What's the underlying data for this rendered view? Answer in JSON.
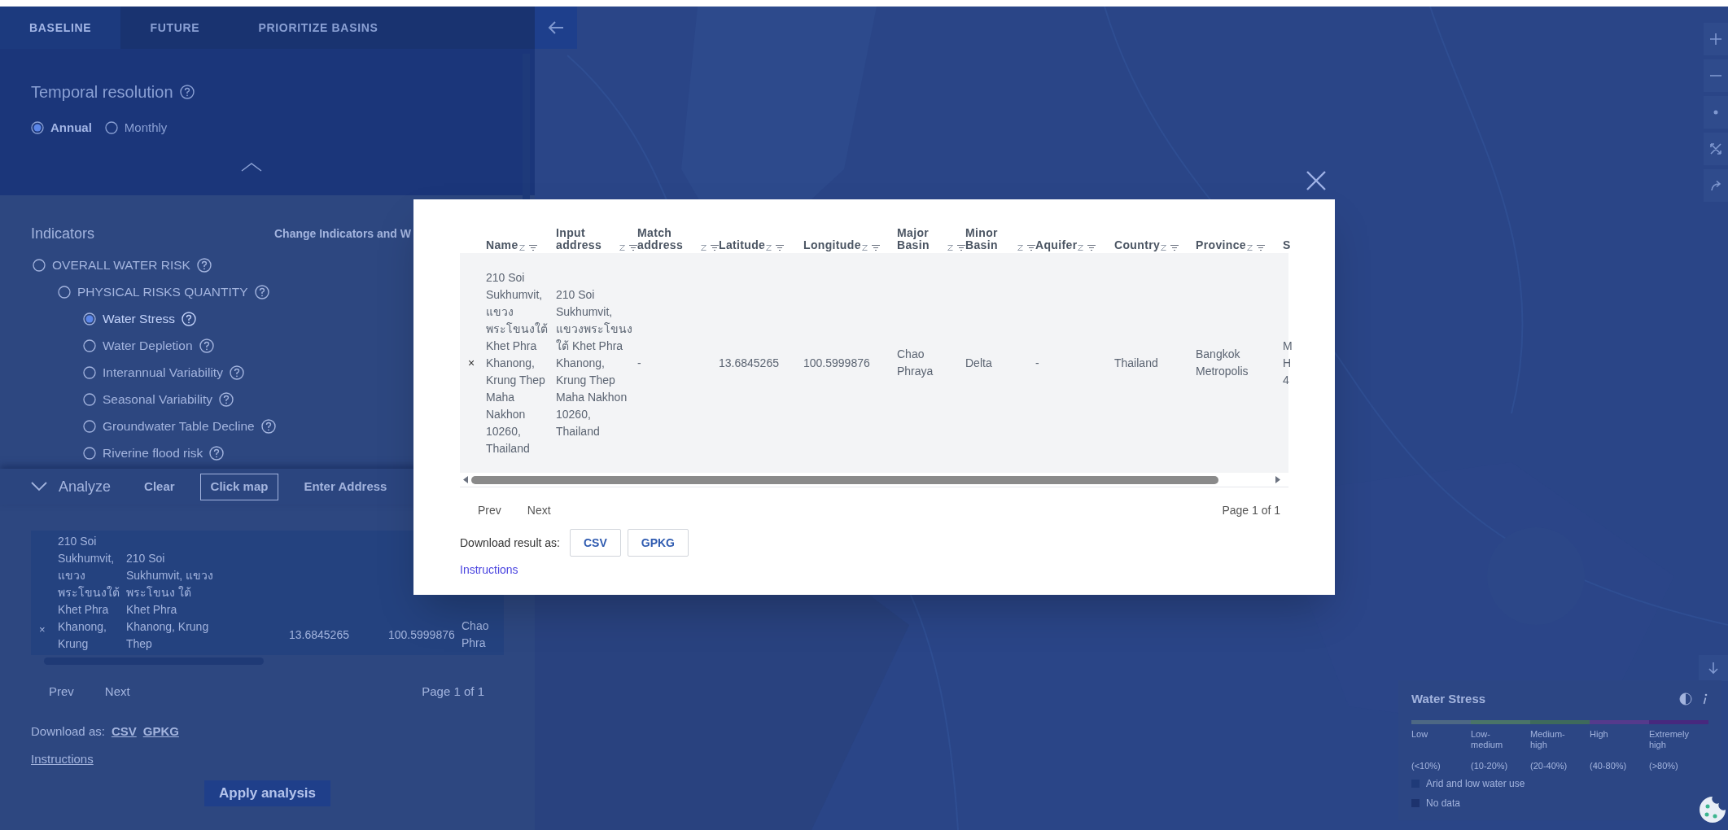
{
  "tabs": [
    {
      "label": "BASELINE",
      "selected": true
    },
    {
      "label": "FUTURE",
      "selected": false
    },
    {
      "label": "PRIORITIZE BASINS",
      "selected": false
    }
  ],
  "temporal_resolution": {
    "title": "Temporal resolution",
    "options": [
      {
        "label": "Annual",
        "selected": true
      },
      {
        "label": "Monthly",
        "selected": false
      }
    ]
  },
  "indicators": {
    "title": "Indicators",
    "change_link": "Change Indicators and W",
    "tree": [
      {
        "label": "OVERALL WATER RISK",
        "selected": false,
        "children": [
          {
            "label": "PHYSICAL RISKS QUANTITY",
            "selected": false,
            "children": [
              {
                "label": "Water Stress",
                "selected": true
              },
              {
                "label": "Water Depletion",
                "selected": false
              },
              {
                "label": "Interannual Variability",
                "selected": false
              },
              {
                "label": "Seasonal Variability",
                "selected": false
              },
              {
                "label": "Groundwater Table Decline",
                "selected": false
              },
              {
                "label": "Riverine flood risk",
                "selected": false
              }
            ]
          }
        ]
      }
    ]
  },
  "analyze": {
    "title": "Analyze",
    "buttons": [
      {
        "label": "Clear",
        "selected": false
      },
      {
        "label": "Click map",
        "selected": true
      },
      {
        "label": "Enter Address",
        "selected": false
      }
    ]
  },
  "side_table": {
    "remove": "×",
    "cells": [
      "210 Soi Sukhumvit, แขวง พระโขนงใต้ Khet Phra Khanong, Krung",
      "210 Soi Sukhumvit, แขวงพระโขนง ใต้ Khet Phra Khanong, Krung Thep",
      "13.6845265",
      "100.5999876",
      "Chao Phra"
    ],
    "pagination": {
      "prev": "Prev",
      "next": "Next",
      "page": "Page 1 of 1"
    }
  },
  "side_download": {
    "label": "Download as:",
    "links": [
      "CSV",
      "GPKG"
    ],
    "instructions": "Instructions"
  },
  "apply_button": "Apply analysis",
  "modal": {
    "columns": [
      "Name",
      "Input address",
      "Match address",
      "Latitude",
      "Longitude",
      "Major Basin",
      "Minor Basin",
      "Aquifer",
      "Country",
      "Province",
      "S"
    ],
    "rows": [
      {
        "remove": "×",
        "cells": [
          "210 Soi Sukhumvit, แขวง พระโขนงใต้ Khet Phra Khanong, Krung Thep Maha Nakhon 10260, Thailand",
          "210 Soi Sukhumvit, แขวงพระโขนง ใต้ Khet Phra Khanong, Krung Thep Maha Nakhon 10260, Thailand",
          "-",
          "13.6845265",
          "100.5999876",
          "Chao Phraya",
          "Delta",
          "-",
          "Thailand",
          "Bangkok Metropolis",
          "M H 4"
        ]
      }
    ],
    "pagination": {
      "prev": "Prev",
      "next": "Next",
      "page": "Page 1 of 1"
    },
    "download": {
      "label": "Download result as:",
      "buttons": [
        "CSV",
        "GPKG"
      ]
    },
    "instructions": "Instructions"
  },
  "legend": {
    "title": "Water Stress",
    "categories": [
      {
        "label": "Low",
        "range": "(<10%)",
        "color": "#4d6884"
      },
      {
        "label": "Low-medium",
        "range": "(10-20%)",
        "color": "#4a7468"
      },
      {
        "label": "Medium-high",
        "range": "(20-40%)",
        "color": "#3e6a5c"
      },
      {
        "label": "High",
        "range": "(40-80%)",
        "color": "#553a8c"
      },
      {
        "label": "Extremely high",
        "range": "(>80%)",
        "color": "#47287e"
      }
    ],
    "extras": [
      {
        "label": "Arid and low water use",
        "color": "#1f3a78"
      },
      {
        "label": "No data",
        "color": "#1d336e"
      }
    ]
  }
}
